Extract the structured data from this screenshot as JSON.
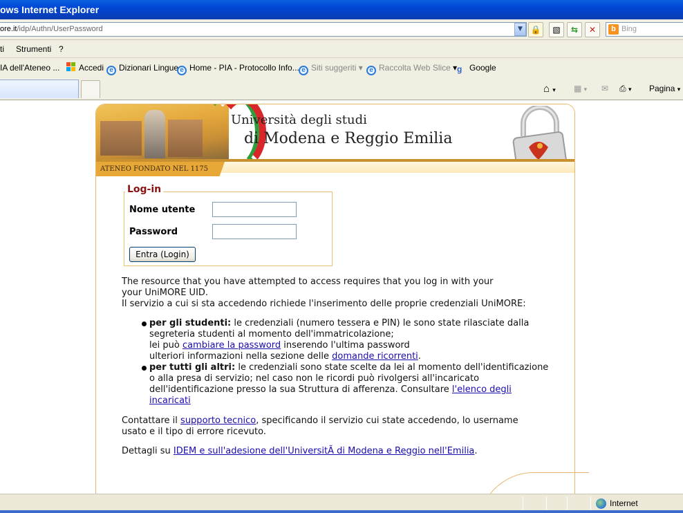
{
  "window": {
    "title": "ows Internet Explorer"
  },
  "address_bar": {
    "host": "ore.it",
    "path": "/idp/Authn/UserPassword"
  },
  "search": {
    "provider": "Bing",
    "placeholder": "Bing"
  },
  "menu": {
    "items": [
      "ti",
      "Strumenti",
      "?"
    ]
  },
  "favorites": {
    "items": [
      {
        "label": "IA dell'Ateneo ..."
      },
      {
        "label": "Accedi"
      },
      {
        "label": "Dizionari Lingue"
      },
      {
        "label": "Home - PIA - Protocollo Info..."
      },
      {
        "label": "Siti suggeriti"
      },
      {
        "label": "Raccolta Web Slice"
      },
      {
        "label": "Google"
      }
    ]
  },
  "command_bar": {
    "page_label": "Pagina"
  },
  "banner": {
    "line1": "Università degli studi",
    "line2": "di Modena e Reggio Emilia",
    "founded": "ATENEO FONDATO NEL 1175"
  },
  "login": {
    "legend": "Log-in",
    "username_label": "Nome utente",
    "username_value": "",
    "password_label": "Password",
    "password_value": "",
    "submit_label": "Entra (Login)"
  },
  "content": {
    "intro_line1": "The resource that you have attempted to access requires that you log in with your",
    "intro_line2": "your UniMORE UID.",
    "intro_line3": "Il servizio a cui si sta accedendo richiede l'inserimento delle proprie credenziali UniMORE:",
    "b1_strong": "per gli studenti:",
    "b1_l1": " le credenziali (numero tessera e PIN) le sono state rilasciate dalla",
    "b1_l2": "segreteria studenti al momento dell'immatricolazione;",
    "b1_l3a": "lei può ",
    "b1_link1": "cambiare la password",
    "b1_l3b": " inserendo l'ultima password",
    "b1_l4a": "ulteriori informazioni nella sezione delle ",
    "b1_link2": "domande ricorrenti",
    "b1_l4b": ".",
    "b2_strong": "per tutti gli altri:",
    "b2_l1": " le credenziali sono state scelte da lei al momento dell'identificazione",
    "b2_l2": "o alla presa di servizio; nel caso non le ricordi può rivolgersi all'incaricato",
    "b2_l3a": "dell'identificazione presso la sua Struttura di afferenza. Consultare ",
    "b2_link1": "l'elenco degli",
    "b2_link2": "incaricati",
    "contact_a": "Contattare il ",
    "contact_link": "supporto tecnico",
    "contact_b": ", specificando il servizio cui state accedendo, lo username",
    "contact_l2": "usato e il tipo di errore ricevuto.",
    "details_a": "Dettagli su ",
    "details_link": "IDEM e sull'adesione dell'UniversitÃ  di Modena e Reggio nell'Emilia",
    "details_b": "."
  },
  "status": {
    "zone": "Internet"
  },
  "colors": {
    "accent_gold": "#e8a838",
    "legend_red": "#8b1212",
    "link": "#1a0dab"
  }
}
